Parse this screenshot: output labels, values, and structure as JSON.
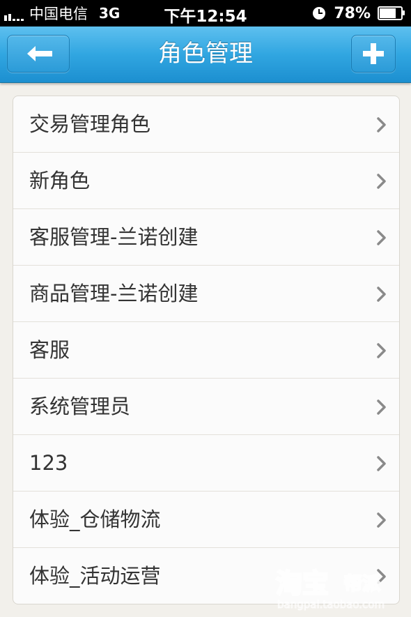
{
  "status_bar": {
    "carrier": "中国电信",
    "network": "3G",
    "time": "下午12:54",
    "battery": "78%",
    "battery_level": 0.78
  },
  "nav": {
    "title": "角色管理",
    "back_icon": "arrow-left-icon",
    "add_icon": "plus-icon"
  },
  "roles": [
    {
      "label": "交易管理角色"
    },
    {
      "label": "新角色"
    },
    {
      "label": "客服管理-兰诺创建"
    },
    {
      "label": "商品管理-兰诺创建"
    },
    {
      "label": "客服"
    },
    {
      "label": "系统管理员"
    },
    {
      "label": "123"
    },
    {
      "label": "体验_仓储物流"
    },
    {
      "label": "体验_活动运营"
    }
  ],
  "colors": {
    "nav_top": "#5ec0ef",
    "nav_bottom": "#1c8fd0",
    "background": "#f2f0eb",
    "text": "#333333",
    "chevron": "#8a8a8a"
  },
  "watermark": {
    "brand": "淘宝帮派",
    "url": "bangpai.taobao.com"
  }
}
